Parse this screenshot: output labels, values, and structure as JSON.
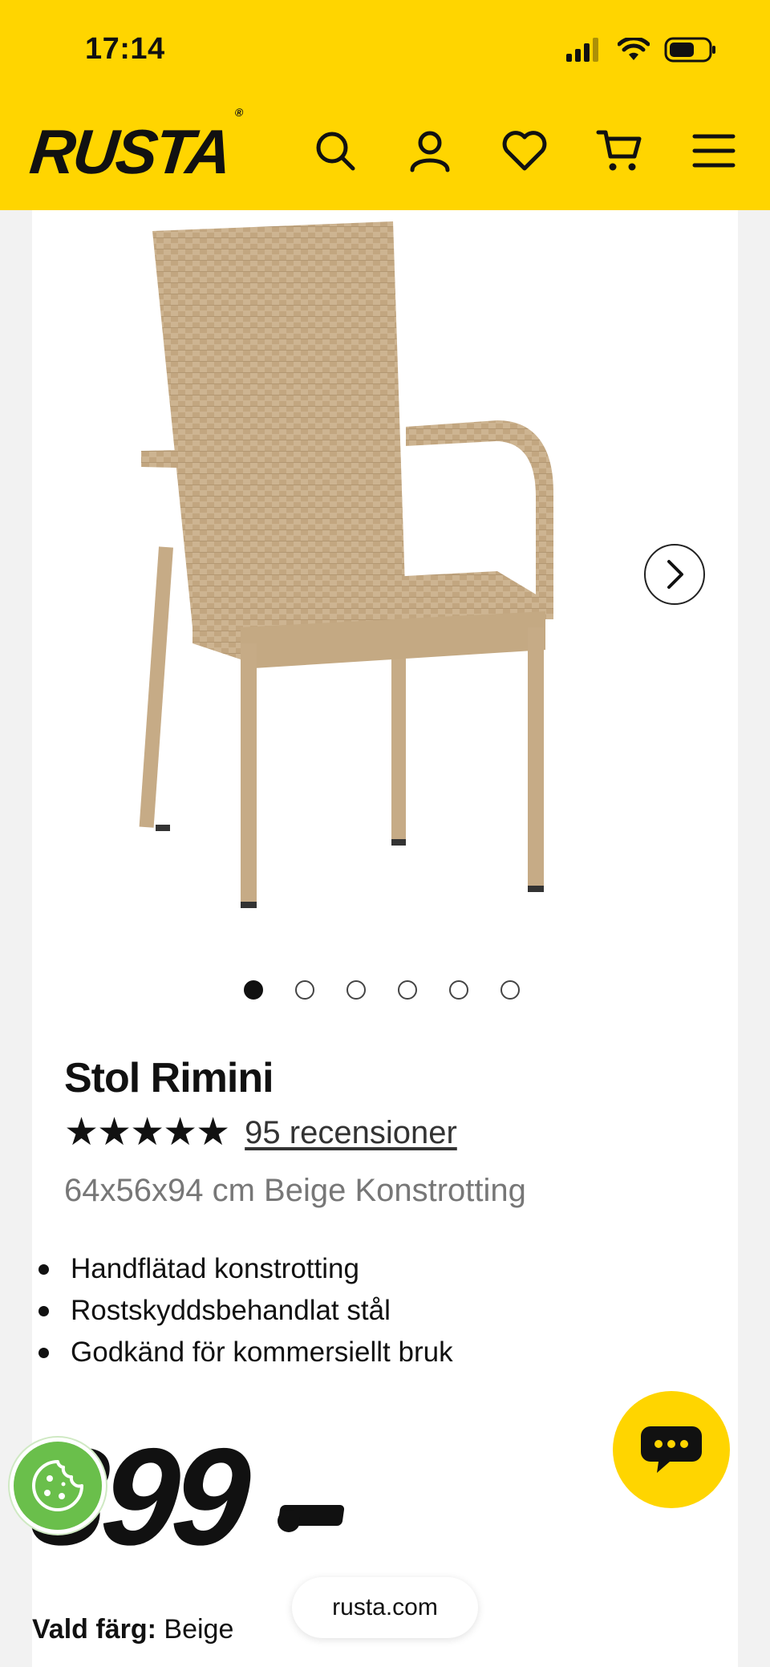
{
  "status_bar": {
    "time": "17:14"
  },
  "header": {
    "logo": "RUSTA",
    "logo_mark": "®",
    "icons": [
      "search-icon",
      "account-icon",
      "heart-icon",
      "cart-icon",
      "menu-icon"
    ]
  },
  "product": {
    "title": "Stol Rimini",
    "stars": "★★★★★",
    "reviews": "95 recensioner",
    "dimensions": "64x56x94 cm Beige Konstrotting",
    "features": [
      "Handflätad konstrotting",
      "Rostskyddsbehandlat stål",
      "Godkänd för kommersiellt bruk"
    ],
    "price": "399",
    "color_label": "Vald färg:",
    "color_value": "Beige"
  },
  "gallery": {
    "image_count": 6,
    "active_index": 0
  },
  "browser": {
    "url": "rusta.com"
  },
  "colors": {
    "brand_yellow": "#ffd500",
    "cookie_green": "#6abf4b",
    "chair": "#cdb491"
  }
}
